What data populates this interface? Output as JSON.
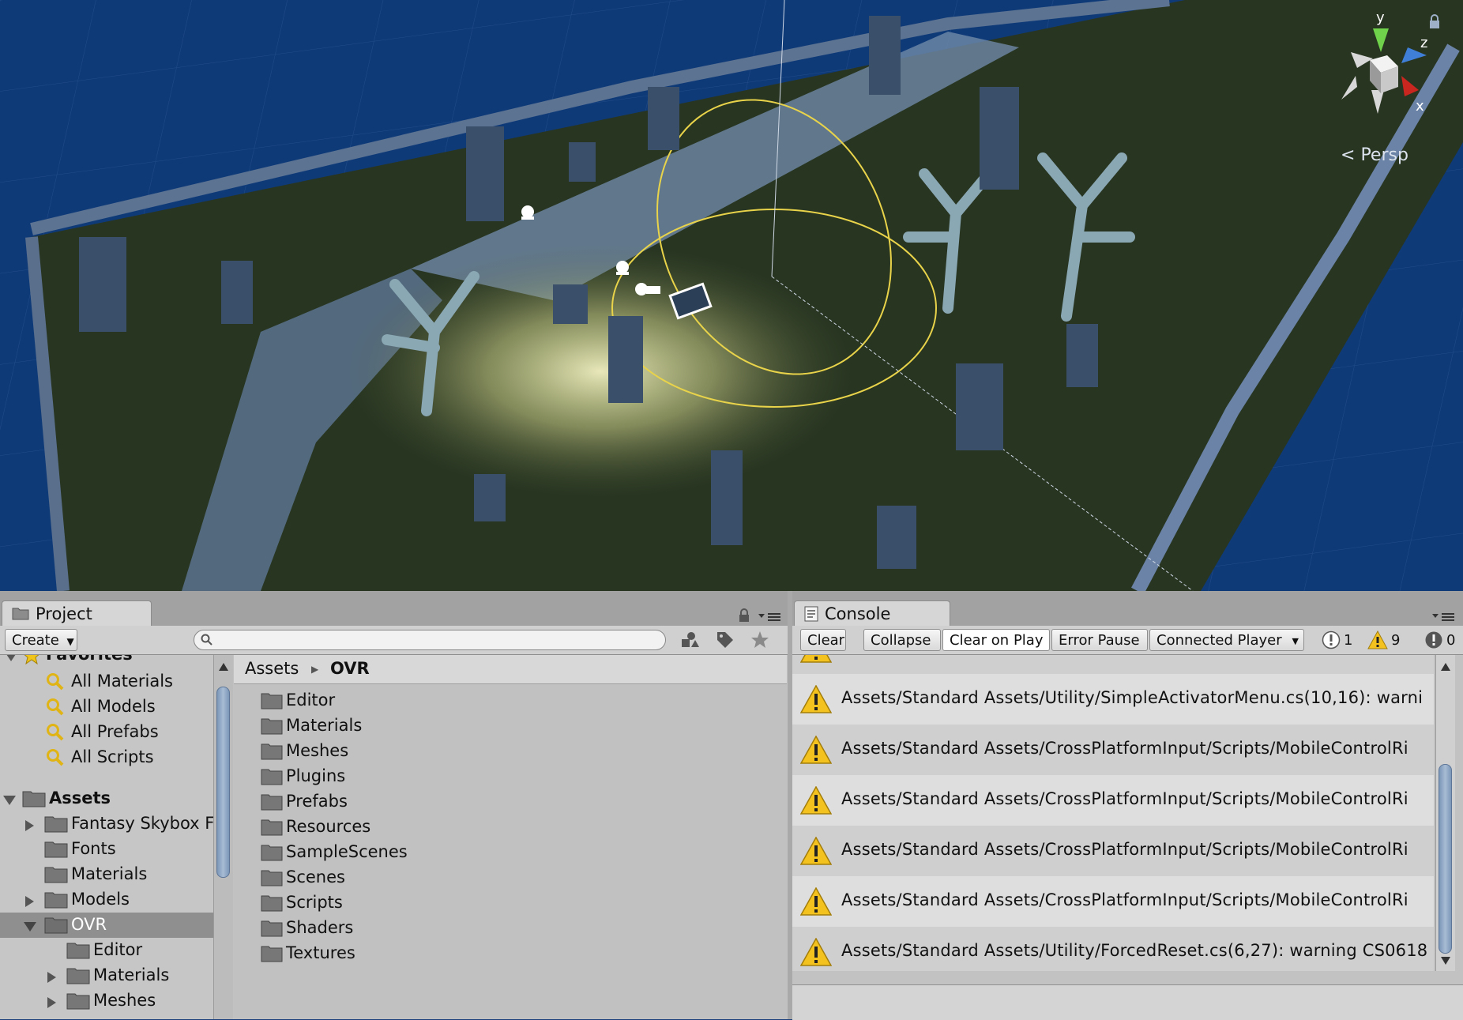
{
  "scene": {
    "projection_label": "Persp",
    "axes": {
      "x": "x",
      "y": "y",
      "z": "z"
    }
  },
  "project": {
    "tab_label": "Project",
    "create_label": "Create",
    "search_placeholder": "",
    "favorites_label": "Favorites",
    "favorites": [
      "All Materials",
      "All Models",
      "All Prefabs",
      "All Scripts"
    ],
    "tree": [
      {
        "label": "Assets",
        "expanded": true,
        "bold": true
      },
      {
        "label": "Fantasy Skybox F",
        "expander": "collapsed"
      },
      {
        "label": "Fonts"
      },
      {
        "label": "Materials"
      },
      {
        "label": "Models",
        "expander": "collapsed"
      },
      {
        "label": "OVR",
        "expander": "expanded",
        "selected": true
      },
      {
        "label": "Editor"
      },
      {
        "label": "Materials",
        "expander": "collapsed"
      },
      {
        "label": "Meshes",
        "expander": "collapsed"
      }
    ],
    "breadcrumb": {
      "root": "Assets",
      "current": "OVR"
    },
    "folders": [
      "Editor",
      "Materials",
      "Meshes",
      "Plugins",
      "Prefabs",
      "Resources",
      "SampleScenes",
      "Scenes",
      "Scripts",
      "Shaders",
      "Textures"
    ]
  },
  "console": {
    "tab_label": "Console",
    "buttons": {
      "clear": "Clear",
      "collapse": "Collapse",
      "clear_on_play": "Clear on Play",
      "error_pause": "Error Pause",
      "connected_player": "Connected Player"
    },
    "counts": {
      "info": "1",
      "warning": "9",
      "error": "0"
    },
    "messages": [
      "Assets/Standard Assets/Utility/SimpleActivatorMenu.cs(10,16): warni",
      "Assets/Standard Assets/CrossPlatformInput/Scripts/MobileControlRi",
      "Assets/Standard Assets/CrossPlatformInput/Scripts/MobileControlRi",
      "Assets/Standard Assets/CrossPlatformInput/Scripts/MobileControlRi",
      "Assets/Standard Assets/CrossPlatformInput/Scripts/MobileControlRi",
      "Assets/Standard Assets/Utility/ForcedReset.cs(6,27): warning CS0618"
    ]
  },
  "colors": {
    "sky": "#0f3a78",
    "ground": "#283521",
    "light_gizmo": "#e8d34a",
    "selection": "#8f8f8f",
    "panel": "#c2c2c2",
    "warning": "#f3c21f"
  }
}
